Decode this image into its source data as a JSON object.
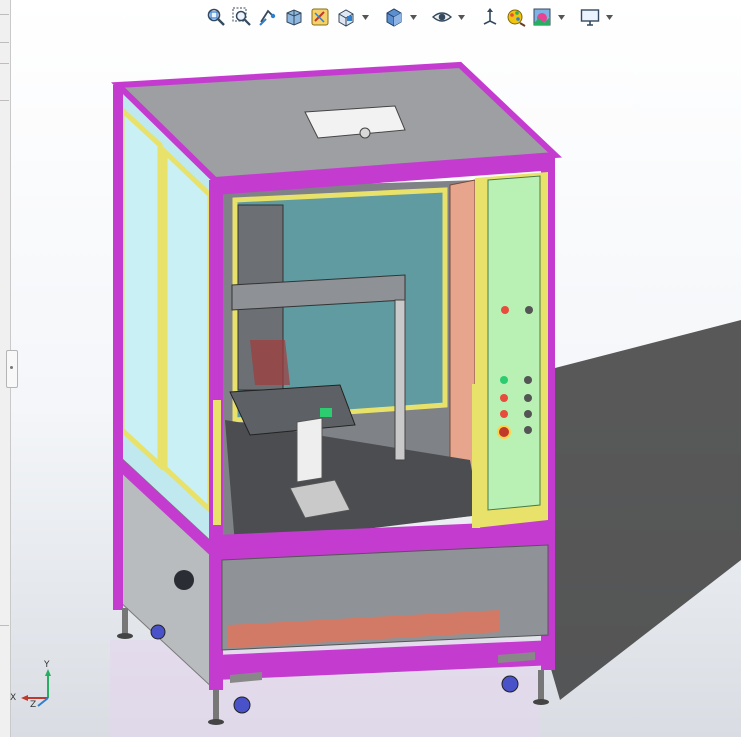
{
  "toolbar": {
    "icons": [
      "zoom-to-fit-icon",
      "zoom-to-area-icon",
      "previous-view-icon",
      "section-view-icon",
      "dynamic-annotation-icon",
      "view-orientation-icon",
      "display-style-icon",
      "hide-show-items-icon",
      "edit-appearance-icon",
      "apply-scene-icon",
      "view-settings-icon"
    ]
  },
  "triad": {
    "x_label": "X",
    "y_label": "Y",
    "z_label": "Z"
  },
  "colors": {
    "frame_magenta": "#c43ccf",
    "panel_yellow": "#e8e26a",
    "glass_cyan": "#bfe9ee",
    "control_panel_green": "#b9f0b4",
    "side_panel_salmon": "#e6a58c",
    "sheet_gray": "#a9abae",
    "base_gray": "#8f9296"
  }
}
